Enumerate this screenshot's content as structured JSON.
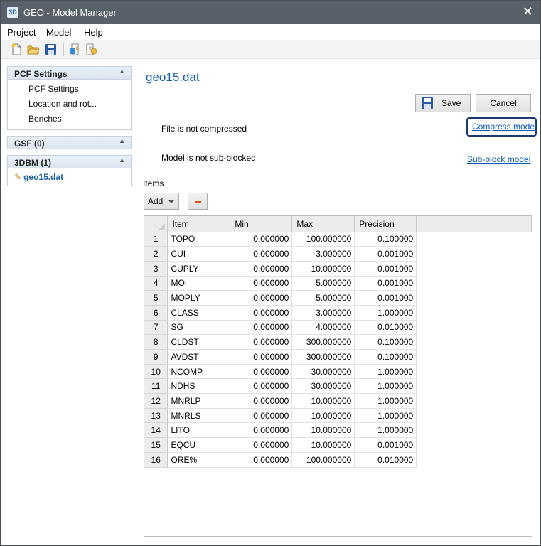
{
  "window": {
    "app_icon_label": "3D",
    "title": "GEO - Model Manager",
    "close_glyph": "✕"
  },
  "menu": [
    "Project",
    "Model",
    "Help"
  ],
  "toolbar": {
    "buttons": [
      "new-file-icon",
      "open-folder-icon",
      "save-disk-icon",
      "import-icon",
      "export-icon"
    ]
  },
  "sidebar": {
    "sections": [
      {
        "title": "PCF Settings",
        "items": [
          "PCF Settings",
          "Location and rot...",
          "Benches"
        ]
      },
      {
        "title": "GSF (0)",
        "items": []
      },
      {
        "title": "3DBM (1)",
        "file": "geo15.dat"
      }
    ],
    "collapse_glyph": "▲"
  },
  "main": {
    "title": "geo15.dat",
    "save_label": "Save",
    "cancel_label": "Cancel",
    "compress_status": "File is not compressed",
    "compress_link": "Compress model",
    "subblock_status": "Model is not sub-blocked",
    "subblock_link": "Sub-block model",
    "items_label": "Items",
    "add_label": "Add"
  },
  "grid": {
    "columns": [
      "Item",
      "Min",
      "Max",
      "Precision"
    ],
    "rows": [
      {
        "n": "1",
        "item": "TOPO",
        "min": "0.000000",
        "max": "100.000000",
        "precision": "0.100000"
      },
      {
        "n": "2",
        "item": "CUI",
        "min": "0.000000",
        "max": "3.000000",
        "precision": "0.001000"
      },
      {
        "n": "3",
        "item": "CUPLY",
        "min": "0.000000",
        "max": "10.000000",
        "precision": "0.001000"
      },
      {
        "n": "4",
        "item": "MOI",
        "min": "0.000000",
        "max": "5.000000",
        "precision": "0.001000"
      },
      {
        "n": "5",
        "item": "MOPLY",
        "min": "0.000000",
        "max": "5.000000",
        "precision": "0.001000"
      },
      {
        "n": "6",
        "item": "CLASS",
        "min": "0.000000",
        "max": "3.000000",
        "precision": "1.000000"
      },
      {
        "n": "7",
        "item": "SG",
        "min": "0.000000",
        "max": "4.000000",
        "precision": "0.010000"
      },
      {
        "n": "8",
        "item": "CLDST",
        "min": "0.000000",
        "max": "300.000000",
        "precision": "0.100000"
      },
      {
        "n": "9",
        "item": "AVDST",
        "min": "0.000000",
        "max": "300.000000",
        "precision": "0.100000"
      },
      {
        "n": "10",
        "item": "NCOMP",
        "min": "0.000000",
        "max": "30.000000",
        "precision": "1.000000"
      },
      {
        "n": "11",
        "item": "NDHS",
        "min": "0.000000",
        "max": "30.000000",
        "precision": "1.000000"
      },
      {
        "n": "12",
        "item": "MNRLP",
        "min": "0.000000",
        "max": "10.000000",
        "precision": "1.000000"
      },
      {
        "n": "13",
        "item": "MNRLS",
        "min": "0.000000",
        "max": "10.000000",
        "precision": "1.000000"
      },
      {
        "n": "14",
        "item": "LITO",
        "min": "0.000000",
        "max": "10.000000",
        "precision": "1.000000"
      },
      {
        "n": "15",
        "item": "EQCU",
        "min": "0.000000",
        "max": "10.000000",
        "precision": "0.001000"
      },
      {
        "n": "16",
        "item": "ORE%",
        "min": "0.000000",
        "max": "100.000000",
        "precision": "0.010000"
      }
    ]
  },
  "colors": {
    "titlebar": "#586069",
    "accent": "#1a5fa8",
    "link": "#0a58b5",
    "remove": "#d9531e"
  }
}
